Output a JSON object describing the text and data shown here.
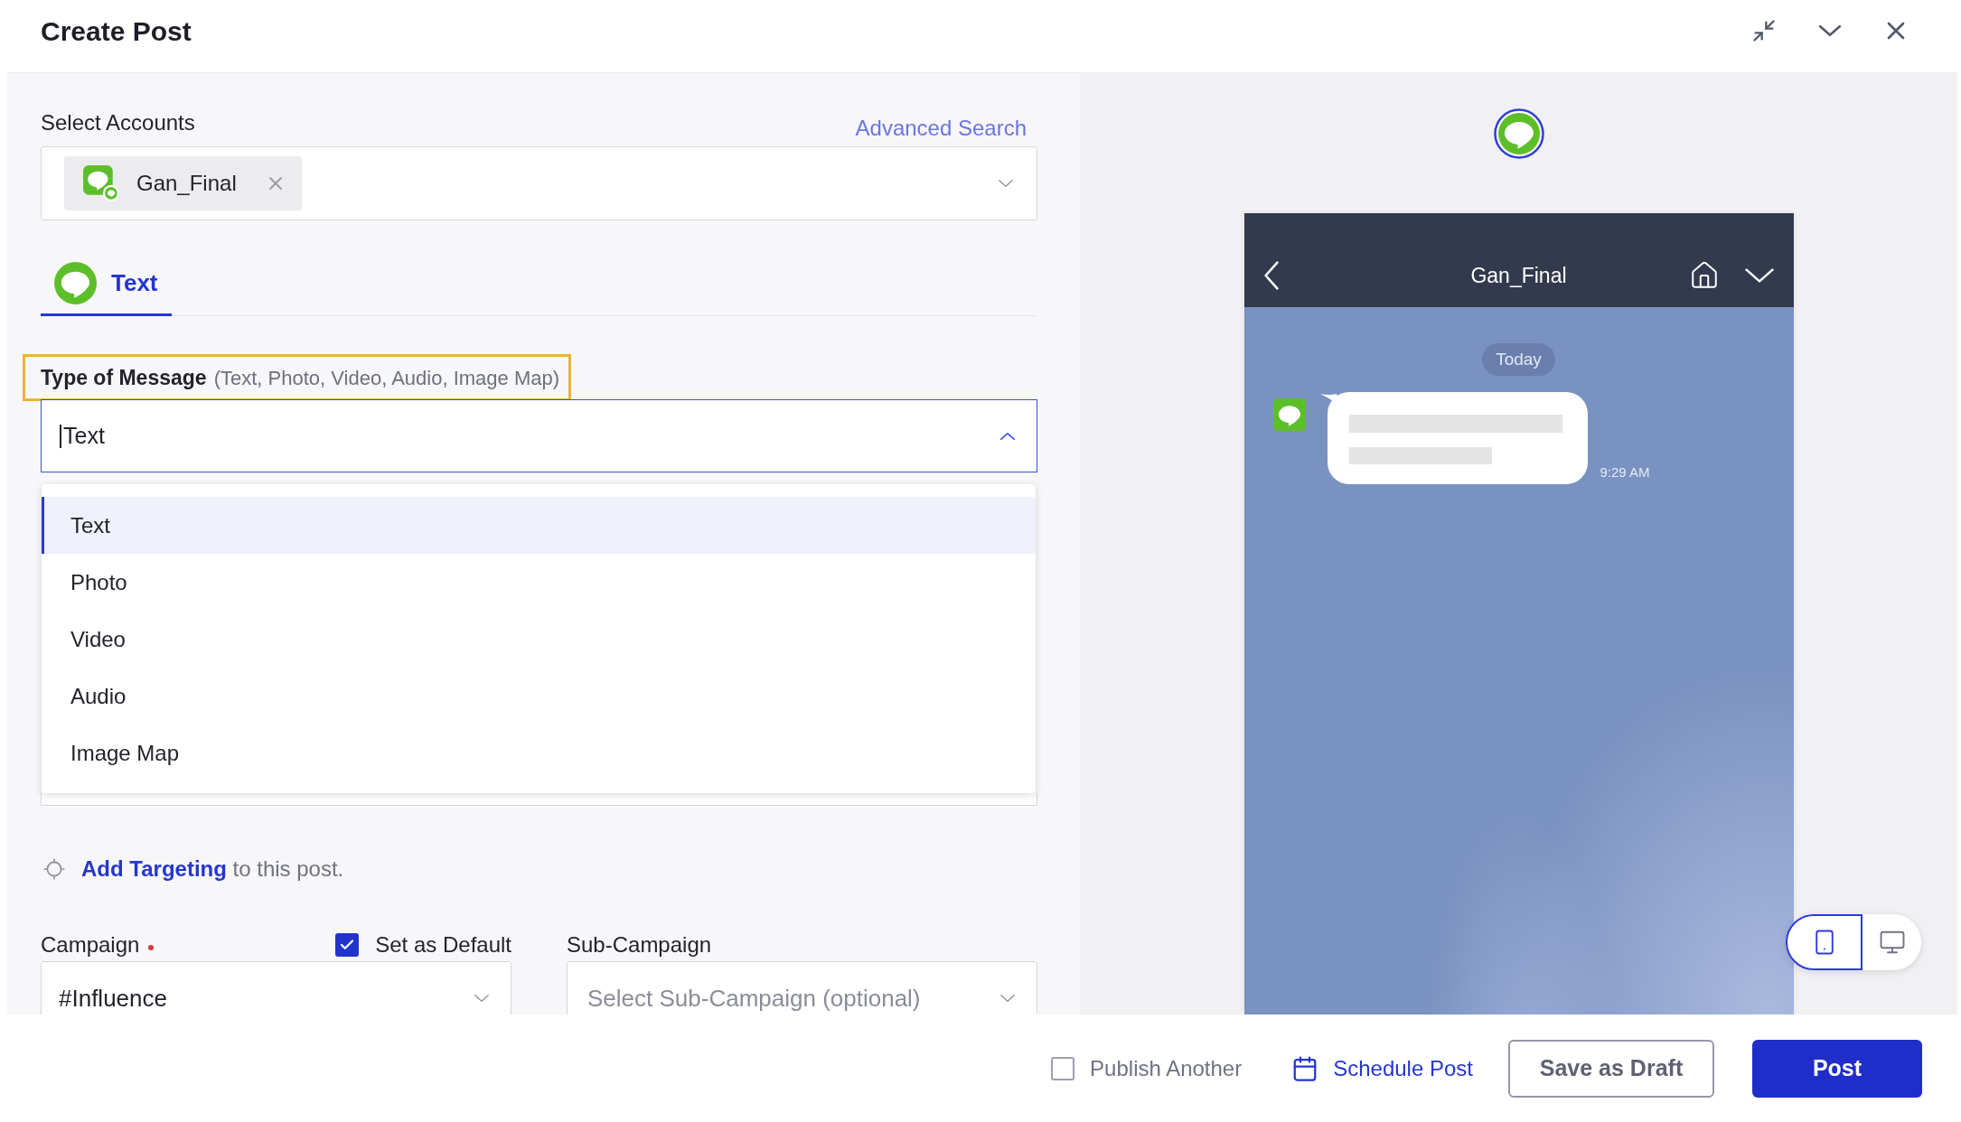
{
  "window": {
    "title": "Create Post"
  },
  "accounts": {
    "label": "Select Accounts",
    "advanced_search": "Advanced Search",
    "selected": [
      {
        "name": "Gan_Final"
      }
    ]
  },
  "channel_tabs": [
    {
      "label": "Text",
      "selected": true
    }
  ],
  "message_type": {
    "label": "Type of Message",
    "hint": "(Text, Photo, Video, Audio, Image Map)",
    "value": "Text",
    "expanded": true,
    "options": [
      {
        "label": "Text",
        "selected": true
      },
      {
        "label": "Photo",
        "selected": false
      },
      {
        "label": "Video",
        "selected": false
      },
      {
        "label": "Audio",
        "selected": false
      },
      {
        "label": "Image Map",
        "selected": false
      }
    ]
  },
  "targeting": {
    "link": "Add Targeting",
    "text": "to this post."
  },
  "campaign": {
    "label": "Campaign",
    "required": true,
    "value": "#Influence"
  },
  "set_as_default": {
    "label": "Set as Default",
    "checked": true
  },
  "sub_campaign": {
    "label": "Sub-Campaign",
    "placeholder": "Select Sub-Campaign (optional)"
  },
  "preview": {
    "account_name": "Gan_Final",
    "date_label": "Today",
    "time": "9:29 AM",
    "devices": [
      {
        "kind": "mobile",
        "selected": true
      },
      {
        "kind": "desktop",
        "selected": false
      }
    ]
  },
  "footer": {
    "publish_another": {
      "label": "Publish Another",
      "checked": false
    },
    "schedule": "Schedule Post",
    "save_draft": "Save as Draft",
    "post": "Post"
  }
}
